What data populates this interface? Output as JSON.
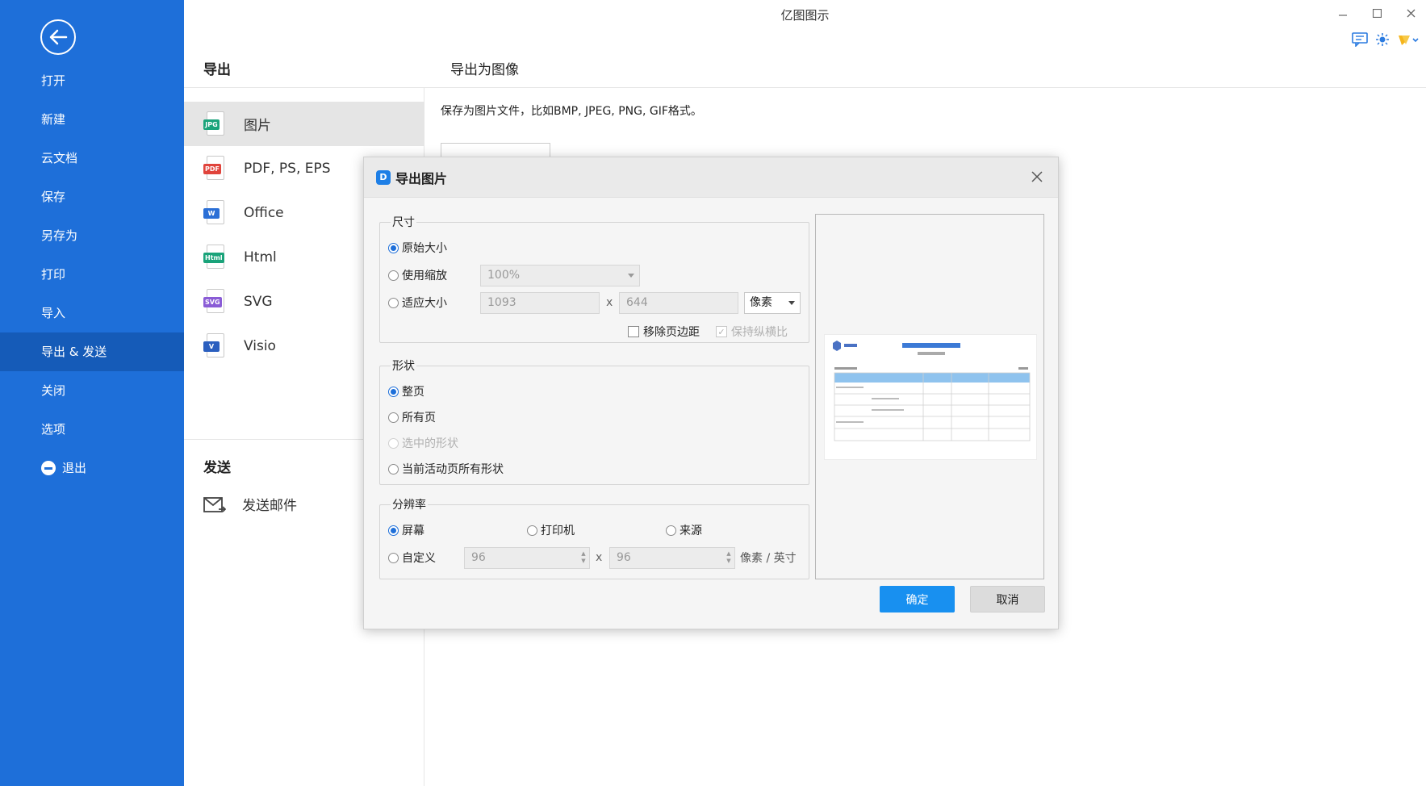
{
  "app": {
    "title": "亿图图示"
  },
  "sidebar": {
    "items": [
      {
        "label": "打开"
      },
      {
        "label": "新建"
      },
      {
        "label": "云文档"
      },
      {
        "label": "保存"
      },
      {
        "label": "另存为"
      },
      {
        "label": "打印"
      },
      {
        "label": "导入"
      },
      {
        "label": "导出 & 发送",
        "active": true
      },
      {
        "label": "关闭"
      },
      {
        "label": "选项"
      },
      {
        "label": "退出"
      }
    ]
  },
  "export": {
    "section_title": "导出",
    "panel_title": "导出为图像",
    "description": "保存为图片文件，比如BMP, JPEG, PNG, GIF格式。",
    "formats": [
      {
        "label": "图片",
        "tag": "JPG",
        "color": "#1aa37a",
        "active": true
      },
      {
        "label": "PDF, PS, EPS",
        "tag": "PDF",
        "color": "#e0443c"
      },
      {
        "label": "Office",
        "tag": "W",
        "color": "#2b6fd6"
      },
      {
        "label": "Html",
        "tag": "Html",
        "color": "#1aa37a"
      },
      {
        "label": "SVG",
        "tag": "SVG",
        "color": "#8a5cd6"
      },
      {
        "label": "Visio",
        "tag": "V",
        "color": "#2b5fbf"
      }
    ],
    "send_title": "发送",
    "send_email": "发送邮件"
  },
  "dialog": {
    "title": "导出图片",
    "size": {
      "legend": "尺寸",
      "original": "原始大小",
      "use_zoom": "使用缩放",
      "zoom_value": "100%",
      "fit_size": "适应大小",
      "width": "1093",
      "height": "644",
      "x": "x",
      "unit": "像素",
      "remove_margin": "移除页边距",
      "keep_ratio": "保持纵横比"
    },
    "shape": {
      "legend": "形状",
      "whole_page": "整页",
      "all_pages": "所有页",
      "selected": "选中的形状",
      "active_page_all": "当前活动页所有形状"
    },
    "resolution": {
      "legend": "分辨率",
      "screen": "屏幕",
      "printer": "打印机",
      "source": "来源",
      "custom": "自定义",
      "dpi_x": "96",
      "dpi_y": "96",
      "x": "x",
      "unit": "像素 / 英寸"
    },
    "ok": "确定",
    "cancel": "取消"
  }
}
